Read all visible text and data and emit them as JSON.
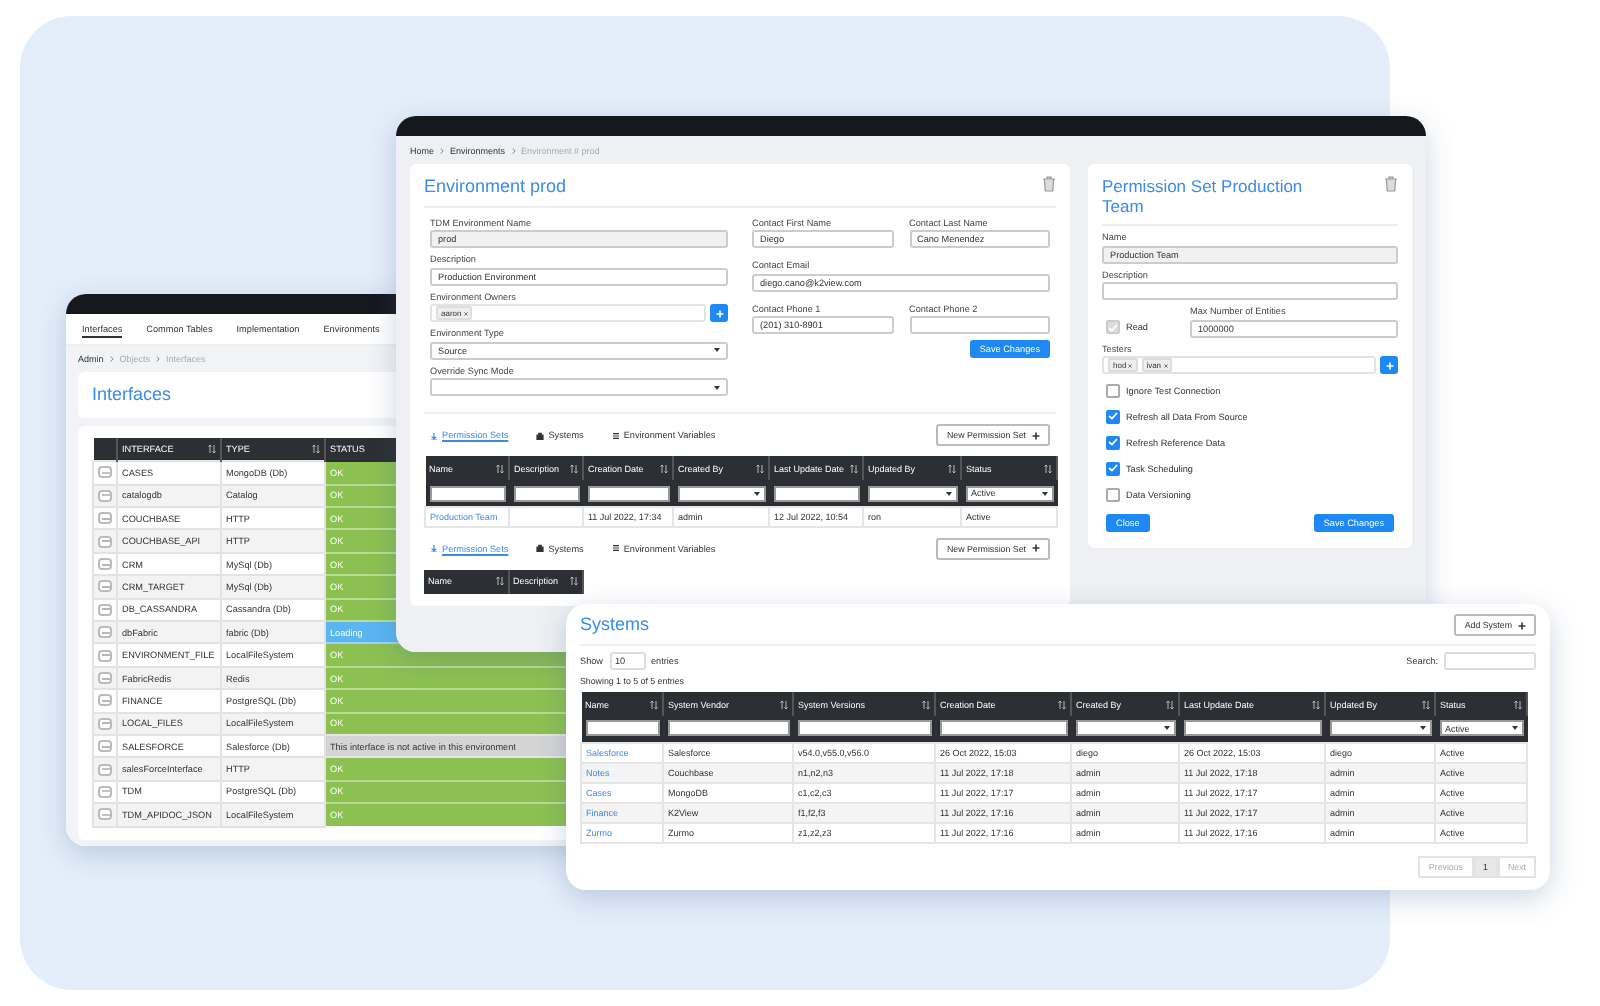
{
  "interfaces_window": {
    "nav_tabs": [
      {
        "label": "Interfaces",
        "selected": true
      },
      {
        "label": "Common Tables",
        "selected": false
      },
      {
        "label": "Implementation",
        "selected": false
      },
      {
        "label": "Environments",
        "selected": false
      }
    ],
    "breadcrumb": [
      "Admin",
      "Objects",
      "Interfaces"
    ],
    "title": "Interfaces",
    "columns": [
      "INTERFACE",
      "TYPE",
      "STATUS"
    ],
    "rows": [
      {
        "interface": "CASES",
        "type": "MongoDB (Db)",
        "status": "OK",
        "kind": "ok"
      },
      {
        "interface": "catalogdb",
        "type": "Catalog",
        "status": "OK",
        "kind": "ok"
      },
      {
        "interface": "COUCHBASE",
        "type": "HTTP",
        "status": "OK",
        "kind": "ok"
      },
      {
        "interface": "COUCHBASE_API",
        "type": "HTTP",
        "status": "OK",
        "kind": "ok"
      },
      {
        "interface": "CRM",
        "type": "MySql (Db)",
        "status": "OK",
        "kind": "ok"
      },
      {
        "interface": "CRM_TARGET",
        "type": "MySql (Db)",
        "status": "OK",
        "kind": "ok"
      },
      {
        "interface": "DB_CASSANDRA",
        "type": "Cassandra (Db)",
        "status": "OK",
        "kind": "ok"
      },
      {
        "interface": "dbFabric",
        "type": "fabric (Db)",
        "status": "Loading",
        "kind": "loading"
      },
      {
        "interface": "ENVIRONMENT_FILE",
        "type": "LocalFileSystem",
        "status": "OK",
        "kind": "ok"
      },
      {
        "interface": "FabricRedis",
        "type": "Redis",
        "status": "OK",
        "kind": "ok"
      },
      {
        "interface": "FINANCE",
        "type": "PostgreSQL (Db)",
        "status": "OK",
        "kind": "ok"
      },
      {
        "interface": "LOCAL_FILES",
        "type": "LocalFileSystem",
        "status": "OK",
        "kind": "ok"
      },
      {
        "interface": "SALESFORCE",
        "type": "Salesforce (Db)",
        "status": "This interface is not active in this environment",
        "kind": "inactive"
      },
      {
        "interface": "salesForceInterface",
        "type": "HTTP",
        "status": "OK",
        "kind": "ok"
      },
      {
        "interface": "TDM",
        "type": "PostgreSQL (Db)",
        "status": "OK",
        "kind": "ok"
      },
      {
        "interface": "TDM_APIDOC_JSON",
        "type": "LocalFileSystem",
        "status": "OK",
        "kind": "ok"
      }
    ]
  },
  "environment_window": {
    "breadcrumb": [
      "Home",
      "Environments",
      "Environment # prod"
    ],
    "title": "Environment prod",
    "left_fields": [
      {
        "label": "TDM Environment Name",
        "value": "prod",
        "kind": "readonly"
      },
      {
        "label": "Description",
        "value": "Production Environment",
        "kind": "text"
      },
      {
        "label": "Environment Owners",
        "chips": [
          "aaron"
        ],
        "kind": "chips"
      },
      {
        "label": "Environment Type",
        "value": "Source",
        "kind": "select"
      },
      {
        "label": "Override Sync Mode",
        "kind": "select"
      }
    ],
    "right_fields": [
      {
        "label": "Contact First Name",
        "value": "Diego",
        "kind": "text"
      },
      {
        "label": "Contact Last Name",
        "value": "Cano Menendez",
        "kind": "text"
      },
      {
        "label": "Contact Email",
        "value": "diego.cano@k2view.com",
        "kind": "wide"
      },
      {
        "label": "Contact Phone 1",
        "value": "(201) 310-8901",
        "kind": "text"
      },
      {
        "label": "Contact Phone 2",
        "kind": "text"
      }
    ],
    "save_button": "Save Changes",
    "sections": [
      {
        "tabs": [
          {
            "label": "Permission Sets",
            "selected": true
          },
          {
            "label": "Systems",
            "selected": false
          },
          {
            "label": "Environment Variables",
            "selected": false
          }
        ],
        "new_button": "New Permission Set",
        "columns": [
          {
            "label": "Name",
            "kind": "text"
          },
          {
            "label": "Description",
            "kind": "text"
          },
          {
            "label": "Creation Date",
            "kind": "text"
          },
          {
            "label": "Created By",
            "kind": "select"
          },
          {
            "label": "Last Update Date",
            "kind": "text"
          },
          {
            "label": "Updated By",
            "kind": "select"
          },
          {
            "label": "Status",
            "kind": "select",
            "filter_value": "Active"
          }
        ],
        "rows": [
          [
            "Production Team",
            "",
            "11 Jul 2022, 17:34",
            "admin",
            "12 Jul 2022, 10:54",
            "ron",
            "Active"
          ]
        ]
      },
      {
        "tabs": [
          {
            "label": "Permission Sets",
            "selected": true
          },
          {
            "label": "Systems",
            "selected": false
          },
          {
            "label": "Environment Variables",
            "selected": false
          }
        ],
        "new_button": "New Permission Set",
        "columns": [
          {
            "label": "Name"
          },
          {
            "label": "Description"
          }
        ]
      }
    ],
    "permission_set": {
      "title": "Permission Set Production Team",
      "name_label": "Name",
      "name_value": "Production Team",
      "description_label": "Description",
      "read": {
        "label": "Read",
        "checked": true
      },
      "max_label": "Max Number of Entities",
      "max_value": "1000000",
      "testers_label": "Testers",
      "testers": [
        "hod",
        "ivan"
      ],
      "options": [
        {
          "label": "Ignore Test Connection",
          "checked": false
        },
        {
          "label": "Refresh all Data From Source",
          "checked": true
        },
        {
          "label": "Refresh Reference Data",
          "checked": true
        },
        {
          "label": "Task Scheduling",
          "checked": true
        },
        {
          "label": "Data Versioning",
          "checked": false
        }
      ],
      "close_button": "Close",
      "save_button": "Save Changes"
    }
  },
  "systems_window": {
    "title": "Systems",
    "add_button": "Add System",
    "show_label": "Show",
    "page_size": "10",
    "entries_label": "entries",
    "search_label": "Search:",
    "info": "Showing 1 to 5 of 5 entries",
    "columns": [
      {
        "label": "Name",
        "kind": "text"
      },
      {
        "label": "System Vendor",
        "kind": "text"
      },
      {
        "label": "System Versions",
        "kind": "text"
      },
      {
        "label": "Creation Date",
        "kind": "text"
      },
      {
        "label": "Created By",
        "kind": "select"
      },
      {
        "label": "Last Update Date",
        "kind": "text"
      },
      {
        "label": "Updated By",
        "kind": "select"
      },
      {
        "label": "Status",
        "kind": "select",
        "filter_value": "Active"
      }
    ],
    "rows": [
      [
        "Salesforce",
        "Salesforce",
        "v54.0,v55.0,v56.0",
        "26 Oct 2022, 15:03",
        "diego",
        "26 Oct 2022, 15:03",
        "diego",
        "Active"
      ],
      [
        "Notes",
        "Couchbase",
        "n1,n2,n3",
        "11 Jul 2022, 17:18",
        "admin",
        "11 Jul 2022, 17:18",
        "admin",
        "Active"
      ],
      [
        "Cases",
        "MongoDB",
        "c1,c2,c3",
        "11 Jul 2022, 17:17",
        "admin",
        "11 Jul 2022, 17:17",
        "admin",
        "Active"
      ],
      [
        "Finance",
        "K2View",
        "f1,f2,f3",
        "11 Jul 2022, 17:16",
        "admin",
        "11 Jul 2022, 17:17",
        "admin",
        "Active"
      ],
      [
        "Zurmo",
        "Zurmo",
        "z1,z2,z3",
        "11 Jul 2022, 17:16",
        "admin",
        "11 Jul 2022, 17:16",
        "admin",
        "Active"
      ]
    ],
    "pagination": [
      {
        "label": "Previous",
        "selected": false
      },
      {
        "label": "1",
        "selected": true
      },
      {
        "label": "Next",
        "selected": false
      }
    ]
  }
}
